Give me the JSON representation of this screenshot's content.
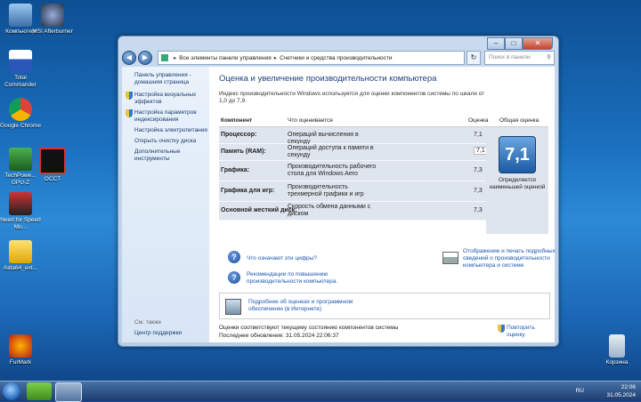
{
  "desktop": {
    "icons": [
      {
        "label": "Компьютер"
      },
      {
        "label": "MSI Afterburner"
      },
      {
        "label": "Total Commander"
      },
      {
        "label": "Google Chrome"
      },
      {
        "label": "TechPowe... GPU-Z"
      },
      {
        "label": "OCCT"
      },
      {
        "label": "Need for Speed Mo..."
      },
      {
        "label": "Aida64_ext..."
      },
      {
        "label": "FurMark"
      },
      {
        "label": "Корзина"
      }
    ]
  },
  "window": {
    "address": {
      "root": "Все элементы панели управления",
      "current": "Счетчики и средства производительности"
    },
    "search_placeholder": "Поиск в панели управления"
  },
  "sidebar": {
    "home_link": "Панель управления - домашняя страница",
    "links": [
      "Настройка визуальных эффектов",
      "Настройка параметров индексирования",
      "Настройка электропитания",
      "Открыть очистку диска",
      "Дополнительные инструменты"
    ],
    "see_also_heading": "См. также",
    "see_also": [
      "Центр поддержки"
    ]
  },
  "main": {
    "title": "Оценка и увеличение производительности компьютера",
    "intro": "Индекс производительности Windows используется для оценки компонентов системы по шкале от 1,0 до 7,9.",
    "table": {
      "headers": {
        "component": "Компонент",
        "rated": "Что оценивается",
        "score": "Оценка",
        "base": "Общая оценка"
      },
      "rows": [
        {
          "component": "Процессор:",
          "rated": "Операций вычисления в секунду",
          "score": "7,1"
        },
        {
          "component": "Память (RAM):",
          "rated": "Операций доступа к памяти в секунду",
          "score": "7,1"
        },
        {
          "component": "Графика:",
          "rated": "Производительность рабочего стола для Windows Aero",
          "score": "7,3"
        },
        {
          "component": "Графика для игр:",
          "rated": "Производительность трехмерной графики и игр",
          "score": "7,3"
        },
        {
          "component": "Основной жесткий диск:",
          "rated": "Скорость обмена данными с диском",
          "score": "7,3"
        }
      ],
      "base_score": "7,1",
      "base_caption": "Определяется наименьшей оценкой"
    },
    "links": {
      "what_mean": "Что означают эти цифры?",
      "recommendations": "Рекомендации по повышению производительности компьютера.",
      "print": "Отображение и печать подробных сведений о производительности компьютера и системе",
      "online": "Подробнее об оценках и программном обеспечении (в Интернете)"
    },
    "footer": {
      "status": "Оценки соответствуют текущему состоянию компонентов системы",
      "last_update": "Последнее обновление: 31.05.2024 22:06:37",
      "rerun": "Повторить оценку"
    }
  },
  "taskbar": {
    "lang": "RU",
    "time": "22:06",
    "date": "31.05.2024"
  }
}
